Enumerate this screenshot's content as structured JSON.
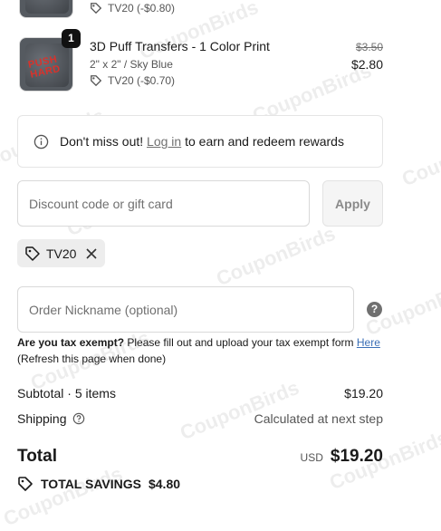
{
  "watermark": "CouponBirds",
  "items": [
    {
      "quantity": "",
      "title": "",
      "variant": "",
      "discount": "TV20 (-$0.80)",
      "original_price": "",
      "price": ""
    },
    {
      "quantity": "1",
      "title": "3D Puff Transfers - 1 Color Print",
      "variant": "2\" x 2\" / Sky Blue",
      "discount": "TV20 (-$0.70)",
      "original_price": "$3.50",
      "price": "$2.80",
      "thumb_print": "PUSH HARD"
    }
  ],
  "rewards": {
    "prefix": "Don't miss out! ",
    "link": "Log in",
    "suffix": " to earn and redeem rewards"
  },
  "discount": {
    "placeholder": "Discount code or gift card",
    "apply_label": "Apply",
    "applied_code": "TV20"
  },
  "nickname": {
    "placeholder": "Order Nickname (optional)",
    "help": "?"
  },
  "tax": {
    "bold": "Are you tax exempt?",
    "text": " Please fill out and upload your tax exempt form ",
    "link": "Here",
    "note": "(Refresh this page when done)"
  },
  "summary": {
    "subtotal_label": "Subtotal · 5 items",
    "subtotal_value": "$19.20",
    "shipping_label": "Shipping",
    "shipping_value": "Calculated at next step",
    "total_label": "Total",
    "currency": "USD",
    "total_value": "$19.20",
    "savings_label": "TOTAL SAVINGS",
    "savings_value": "$4.80"
  }
}
